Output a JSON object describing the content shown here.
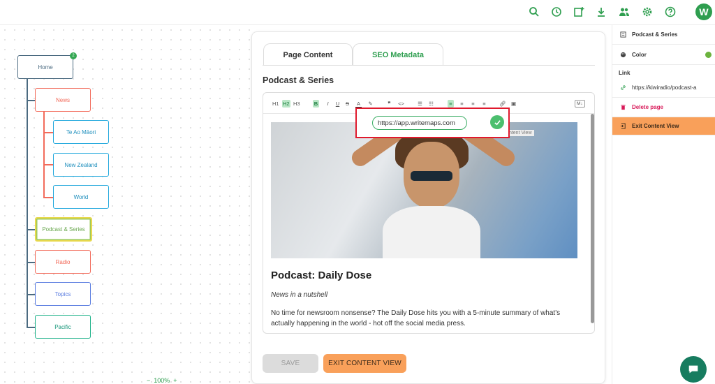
{
  "colors": {
    "accent_green": "#2e9e4f",
    "orange": "#f9a05a",
    "red_highlight": "#e0192d"
  },
  "topbar": {
    "icons": [
      "search-icon",
      "history-icon",
      "add-page-icon",
      "download-icon",
      "users-icon",
      "gear-icon",
      "help-icon"
    ],
    "avatar_letter": "W"
  },
  "sitemap": {
    "home": {
      "label": "Home",
      "badge": "2"
    },
    "news": {
      "label": "News"
    },
    "te_ao_maori": {
      "label": "Te Ao Māori"
    },
    "new_zealand": {
      "label": "New Zealand"
    },
    "world": {
      "label": "World"
    },
    "podcast_series": {
      "label": "Podcast & Series"
    },
    "radio": {
      "label": "Radio"
    },
    "topics": {
      "label": "Topics"
    },
    "pacific": {
      "label": "Pacific"
    }
  },
  "panel": {
    "tabs": [
      {
        "label": "Page Content"
      },
      {
        "label": "SEO Metadata"
      }
    ],
    "title": "Podcast & Series",
    "toolbar": {
      "h1": "H1",
      "h2": "H2",
      "h3": "H3",
      "bold": "B",
      "italic": "I",
      "underline": "U",
      "strike": "S",
      "font_color": "A",
      "markdown": "M↓"
    },
    "link_popup": {
      "value": "https://app.writemaps.com"
    },
    "content_view_tag": "Content View",
    "article": {
      "title": "Podcast: Daily Dose",
      "subtitle": "News in a nutshell",
      "body": "No time for newsroom nonsense? The Daily Dose hits you with a 5-minute summary of what's actually happening in the world - hot off the social media press."
    },
    "save_label": "SAVE",
    "exit_label": "EXIT CONTENT VIEW"
  },
  "sidebar": {
    "page_name": "Podcast & Series",
    "color_label": "Color",
    "link_heading": "Link",
    "link_value": "https://kiwiradio/podcast-a",
    "delete_label": "Delete page",
    "exit_label": "Exit Content View"
  },
  "zoom": {
    "level": "100%"
  }
}
